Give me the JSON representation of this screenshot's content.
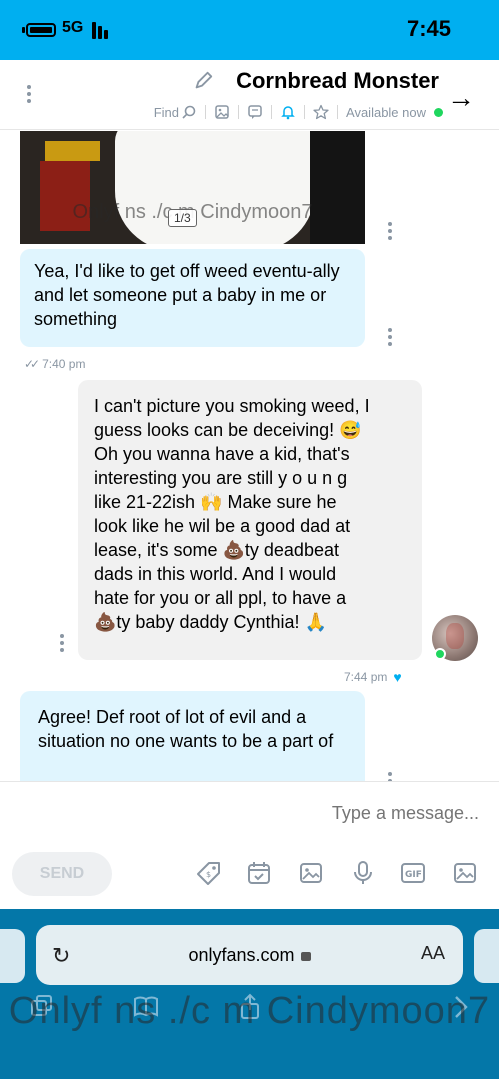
{
  "status_bar": {
    "time": "7:45",
    "network": "5G"
  },
  "header": {
    "name": "Cornbread Monster",
    "status": "Available now",
    "find_label": "Find"
  },
  "messages": [
    {
      "type": "media",
      "watermark": "Onlyf ns ./c m Cindymoon7",
      "counter": "1/3"
    },
    {
      "type": "text",
      "direction": "incoming",
      "text": "Yea, I'd like to get off weed eventu-ally and let someone put a baby in me or something",
      "time": "7:40 pm",
      "status": "read"
    },
    {
      "type": "text",
      "direction": "outgoing",
      "lines": [
        "I can't picture you smoking weed, I",
        "guess looks can be deceiving! 😅",
        "Oh you wanna have a kid, that's",
        "interesting you are still y o u n g",
        "like 21-22ish 🙌 Make sure he",
        "look like he wil be a good dad at",
        "lease, it's some 💩ty deadbeat",
        "dads in this world. And I would",
        "hate for you or all ppl, to have a",
        "💩ty baby daddy Cynthia! 🙏"
      ],
      "time": "7:44 pm",
      "liked": true
    },
    {
      "type": "text",
      "direction": "incoming",
      "text": "Agree! Def root of lot of evil and a situation no one wants to be a part of"
    }
  ],
  "composer": {
    "placeholder": "Type a message...",
    "send_label": "SEND"
  },
  "browser": {
    "url": "onlyfans.com",
    "aa": "AA",
    "watermark": "Onlyf ns ./c m Cindymoon7"
  },
  "colors": {
    "accent": "#00aff0",
    "incoming_bubble": "#e0f5fe",
    "outgoing_bubble": "#f1f1f1",
    "online": "#1fd65e",
    "browser_bar": "#0477a8"
  }
}
